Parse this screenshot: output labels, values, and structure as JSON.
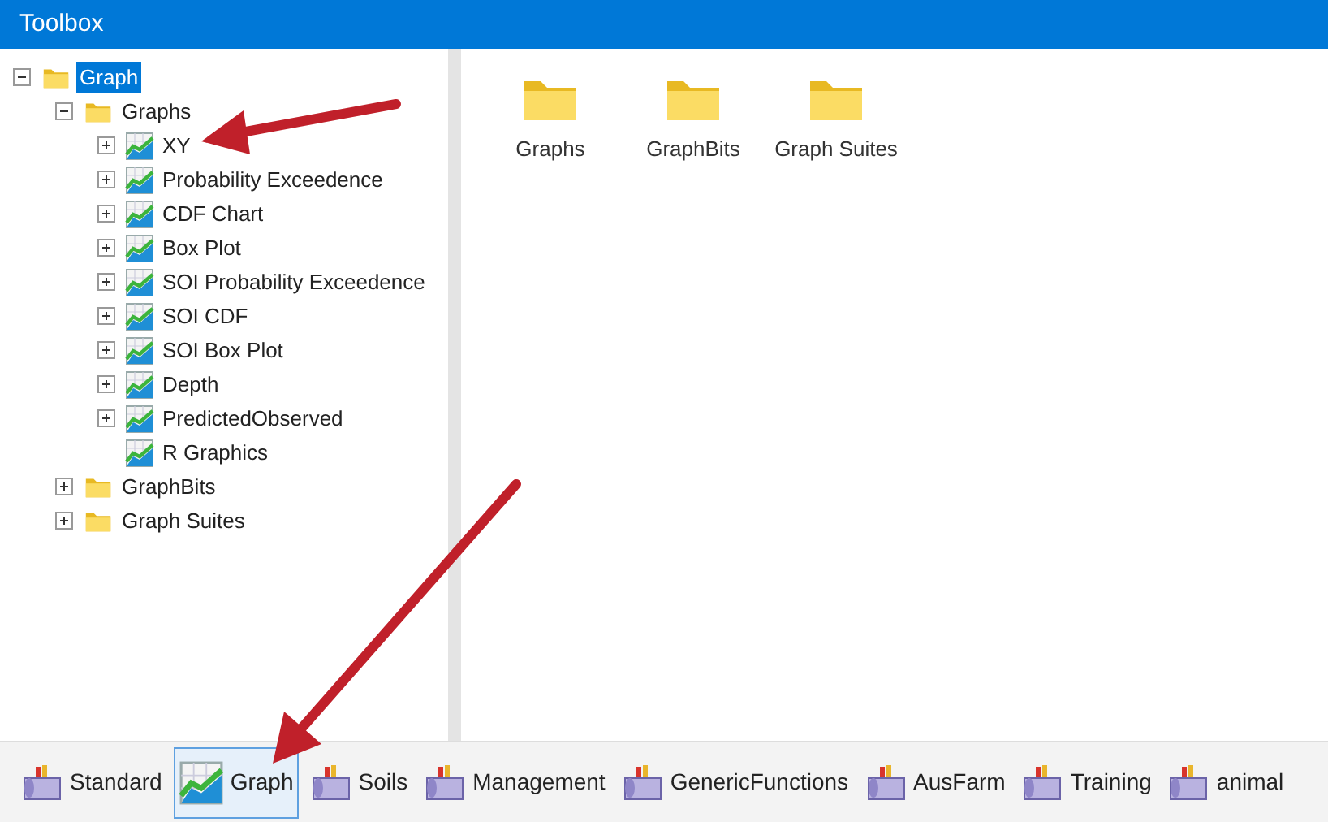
{
  "window": {
    "title": "Toolbox"
  },
  "tree": [
    {
      "label": "Graph",
      "kind": "folder",
      "expandable": true,
      "expanded": true,
      "selected": true,
      "children": [
        {
          "label": "Graphs",
          "kind": "folder",
          "expandable": true,
          "expanded": true,
          "selected": false,
          "children": [
            {
              "label": "XY",
              "kind": "graph",
              "expandable": true,
              "selected": false
            },
            {
              "label": "Probability Exceedence",
              "kind": "graph",
              "expandable": true,
              "selected": false
            },
            {
              "label": "CDF Chart",
              "kind": "graph",
              "expandable": true,
              "selected": false
            },
            {
              "label": "Box Plot",
              "kind": "graph",
              "expandable": true,
              "selected": false
            },
            {
              "label": "SOI Probability Exceedence",
              "kind": "graph",
              "expandable": true,
              "selected": false
            },
            {
              "label": "SOI CDF",
              "kind": "graph",
              "expandable": true,
              "selected": false
            },
            {
              "label": "SOI Box Plot",
              "kind": "graph",
              "expandable": true,
              "selected": false
            },
            {
              "label": "Depth",
              "kind": "graph",
              "expandable": true,
              "selected": false
            },
            {
              "label": "PredictedObserved",
              "kind": "graph",
              "expandable": true,
              "selected": false
            },
            {
              "label": "R Graphics",
              "kind": "graph",
              "expandable": false,
              "selected": false
            }
          ]
        },
        {
          "label": "GraphBits",
          "kind": "folder",
          "expandable": true,
          "expanded": false,
          "selected": false
        },
        {
          "label": "Graph Suites",
          "kind": "folder",
          "expandable": true,
          "expanded": false,
          "selected": false
        }
      ]
    }
  ],
  "contents": [
    {
      "label": "Graphs"
    },
    {
      "label": "GraphBits"
    },
    {
      "label": "Graph Suites"
    }
  ],
  "toolbar": [
    {
      "label": "Standard",
      "kind": "toolbox",
      "selected": false
    },
    {
      "label": "Graph",
      "kind": "graph",
      "selected": true
    },
    {
      "label": "Soils",
      "kind": "toolbox",
      "selected": false
    },
    {
      "label": "Management",
      "kind": "toolbox",
      "selected": false
    },
    {
      "label": "GenericFunctions",
      "kind": "toolbox",
      "selected": false
    },
    {
      "label": "AusFarm",
      "kind": "toolbox",
      "selected": false
    },
    {
      "label": "Training",
      "kind": "toolbox",
      "selected": false
    },
    {
      "label": "animal",
      "kind": "toolbox",
      "selected": false
    }
  ]
}
